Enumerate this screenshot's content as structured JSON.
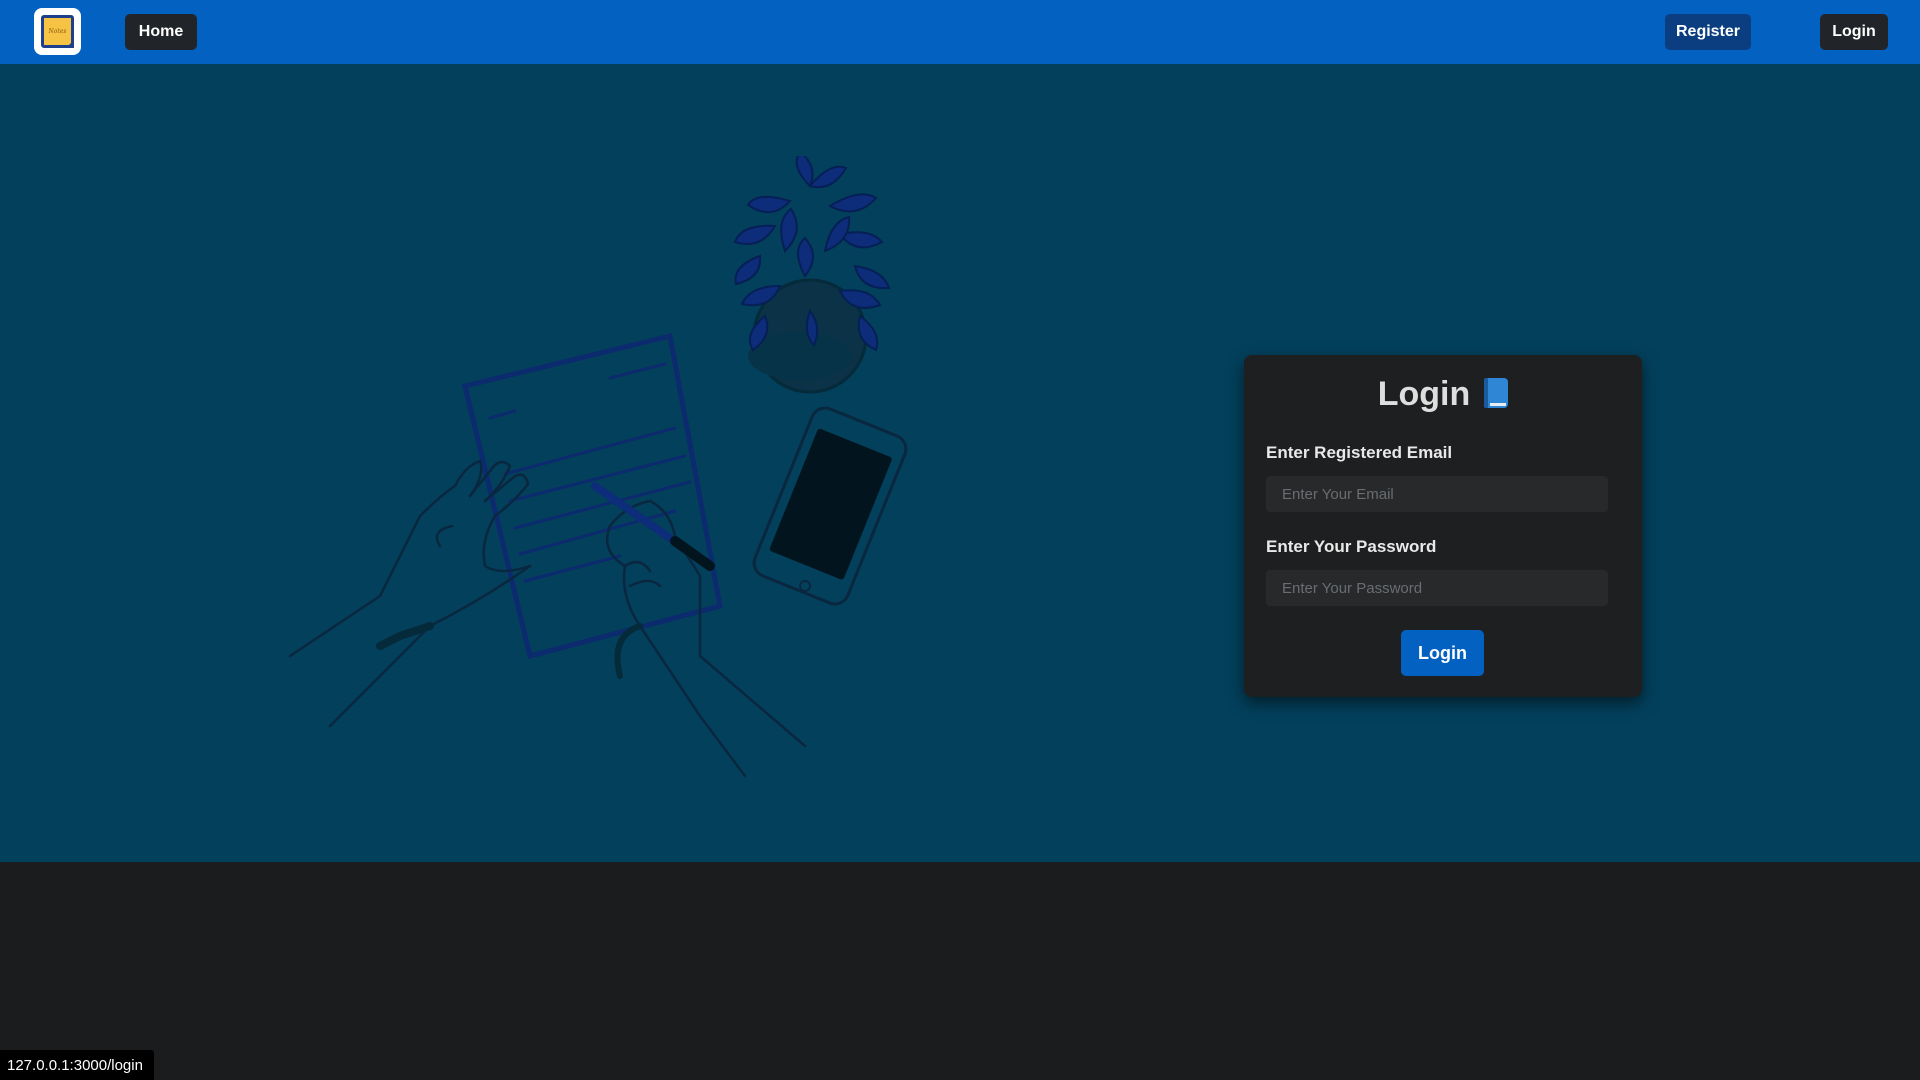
{
  "navbar": {
    "logo_text": "Notes",
    "home_label": "Home",
    "register_label": "Register",
    "login_label": "Login"
  },
  "login_card": {
    "title": "Login",
    "title_icon": "blue-book-icon",
    "email_label": "Enter Registered Email",
    "email_placeholder": "Enter Your Email",
    "email_value": "",
    "password_label": "Enter Your Password",
    "password_placeholder": "Enter Your Password",
    "password_value": "",
    "submit_label": "Login"
  },
  "illustration": {
    "icon": "writing-desk-illustration"
  },
  "status_bar": {
    "url": "127.0.0.1:3000/login"
  },
  "colors": {
    "navbar": "#0261c1",
    "hero_background": "#03405c",
    "page_background": "#1b1c1e",
    "card_background": "#1e1f21",
    "dark_button": "#212529",
    "register_button": "#0b3e80",
    "primary_button": "#0261c1"
  }
}
